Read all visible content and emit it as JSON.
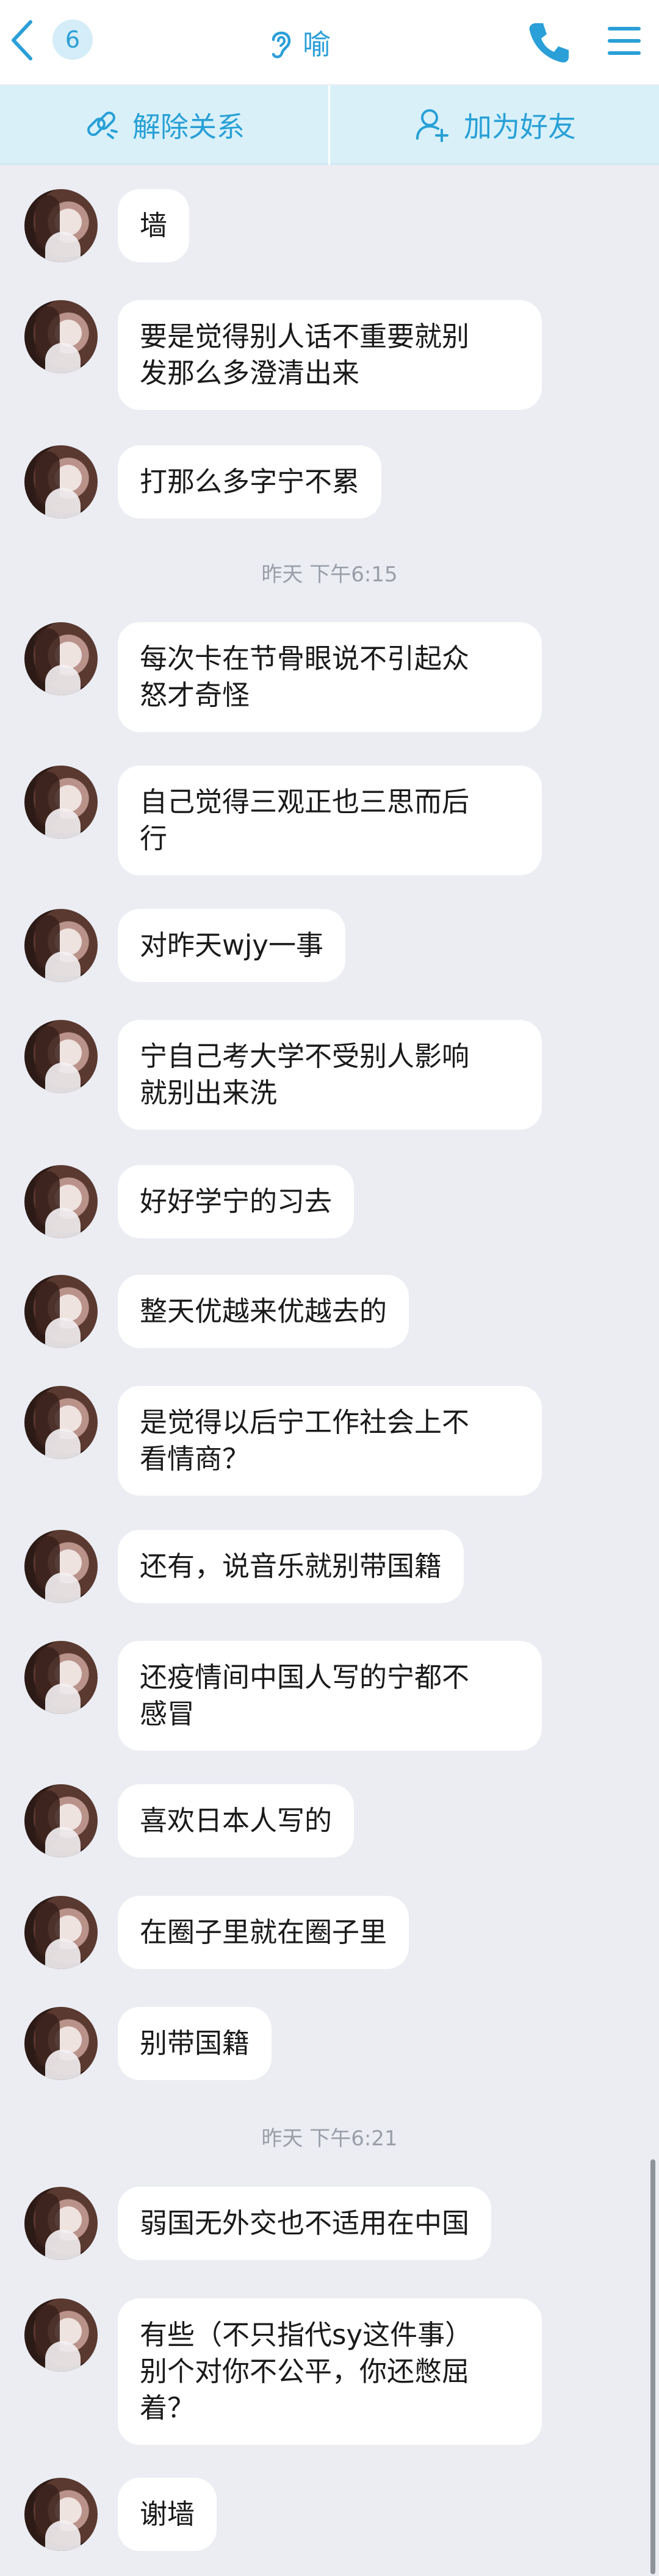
{
  "header": {
    "unread_count": "6",
    "title": "喻"
  },
  "actions": {
    "remove_relation": "解除关系",
    "add_friend": "加为好友"
  },
  "messages": [
    {
      "text": "墙"
    },
    {
      "text": "要是觉得别人话不重要就别\n发那么多澄清出来"
    },
    {
      "text": "打那么多字宁不累"
    },
    {
      "time": "昨天 下午6:15"
    },
    {
      "text": "每次卡在节骨眼说不引起众\n怒才奇怪"
    },
    {
      "text": "自己觉得三观正也三思而后\n行"
    },
    {
      "text": "对昨天wjy一事"
    },
    {
      "text": "宁自己考大学不受别人影响\n就别出来洗"
    },
    {
      "text": "好好学宁的习去"
    },
    {
      "text": "整天优越来优越去的"
    },
    {
      "text": "是觉得以后宁工作社会上不\n看情商？"
    },
    {
      "text": "还有，说音乐就别带国籍"
    },
    {
      "text": "还疫情间中国人写的宁都不\n感冒"
    },
    {
      "text": "喜欢日本人写的"
    },
    {
      "text": "在圈子里就在圈子里"
    },
    {
      "text": "别带国籍"
    },
    {
      "time": "昨天 下午6:21"
    },
    {
      "text": "弱国无外交也不适用在中国"
    },
    {
      "text": "有些（不只指代sy这件事）\n别个对你不公平，你还憋屈\n着？"
    },
    {
      "text": "谢墙"
    }
  ],
  "colors": {
    "accent": "#2a9fd8",
    "background": "#ebedf3",
    "action_bar": "#d9f0f9",
    "bubble": "#ffffff"
  },
  "icons": [
    "back-chevron-icon",
    "ear-icon",
    "phone-icon",
    "menu-icon",
    "unlink-icon",
    "add-user-icon",
    "avatar"
  ]
}
